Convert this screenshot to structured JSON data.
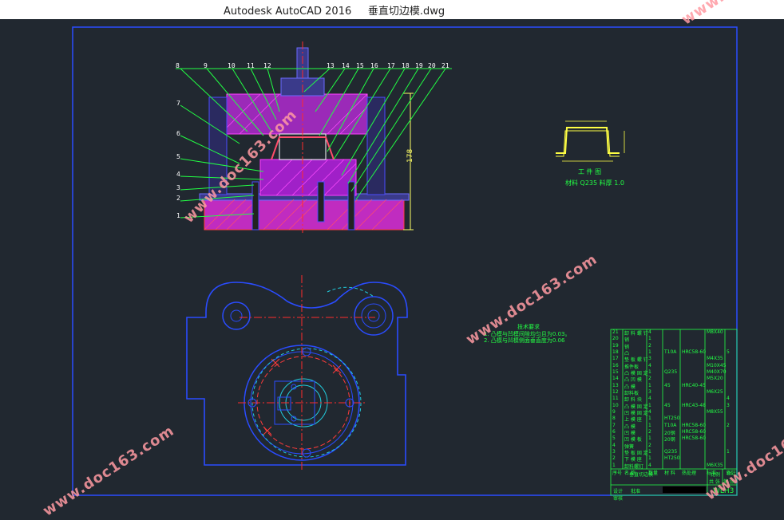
{
  "window": {
    "title": "Autodesk AutoCAD 2016     垂直切边模.dwg"
  },
  "watermark": "www.doc163.com",
  "leaders": [
    "8",
    "9",
    "10",
    "11",
    "12",
    "13",
    "14",
    "15",
    "16",
    "17",
    "18",
    "19",
    "20",
    "21",
    "7",
    "6",
    "5",
    "4",
    "3",
    "2",
    "1"
  ],
  "dimension": "178",
  "workpiece": {
    "caption": "工 件 图",
    "material": "材料 Q235   料厚 1.0"
  },
  "notes": {
    "heading": "技术要求",
    "lines": [
      "1. 凸模与凹模间隙均匀且为0.03。",
      "2. 凸模与凹模侧面垂直度为0.06"
    ]
  },
  "bom": {
    "rows": [
      [
        "21",
        "卸 料 螺 钉",
        "4",
        "",
        "",
        "M8X40",
        ""
      ],
      [
        "20",
        "销",
        "1",
        "",
        "",
        "",
        ""
      ],
      [
        "19",
        "销",
        "2",
        "",
        "",
        "",
        ""
      ],
      [
        "18",
        "凸",
        "1",
        "T10A",
        "HRC58-60",
        "",
        "5"
      ],
      [
        "17",
        "垫 板 螺 钉",
        "3",
        "",
        "",
        "M4X35",
        ""
      ],
      [
        "16",
        "推件板",
        "4",
        "",
        "",
        "M10X45",
        ""
      ],
      [
        "15",
        "凸 模 固 定",
        "1",
        "Q235",
        "",
        "M40X70",
        ""
      ],
      [
        "14",
        "凸 凹 模",
        "2",
        "",
        "",
        "M5X20",
        ""
      ],
      [
        "13",
        "凸 模",
        "1",
        "45",
        "HRC40-45",
        "",
        ""
      ],
      [
        "12",
        "卸料板",
        "3",
        "",
        "",
        "M6X25",
        ""
      ],
      [
        "11",
        "卸 料 块",
        "4",
        "",
        "",
        "",
        "4"
      ],
      [
        "10",
        "凸 模 固 定",
        "1",
        "45",
        "HRC43-48",
        "",
        "3"
      ],
      [
        "9",
        "凹 模 固 定",
        "4",
        "",
        "",
        "M8X55",
        ""
      ],
      [
        "8",
        "上 模 座",
        "1",
        "HT250",
        "",
        "",
        ""
      ],
      [
        "7",
        "凸 模",
        "1",
        "T10A",
        "HRC58-60",
        "",
        "2"
      ],
      [
        "6",
        "凹 模",
        "2",
        "20钢",
        "HRC58-60",
        "",
        ""
      ],
      [
        "5",
        "凹 模 板",
        "1",
        "20钢",
        "HRC58-60",
        "",
        ""
      ],
      [
        "4",
        "弹簧",
        "2",
        "",
        "",
        "",
        ""
      ],
      [
        "3",
        "垫 板 固 定",
        "1",
        "Q235",
        "",
        "",
        "1"
      ],
      [
        "2",
        "下 模 座",
        "1",
        "HT250",
        "",
        "",
        ""
      ],
      [
        "1",
        "卸料螺钉",
        "4",
        "",
        "",
        "M6X35",
        ""
      ]
    ],
    "header": [
      "序号",
      "名 称",
      "数量",
      "材 料",
      "热处理",
      "标准",
      "备注"
    ],
    "footer": {
      "title": "垂直切边模",
      "scale_label": "比例",
      "scale": "1:1",
      "sheet_label": "共 张",
      "sheet": "第 张",
      "drawing_no": "WLH3",
      "designer_label": "设计",
      "checker_label": "审核",
      "reviewer_label": "批准"
    }
  }
}
